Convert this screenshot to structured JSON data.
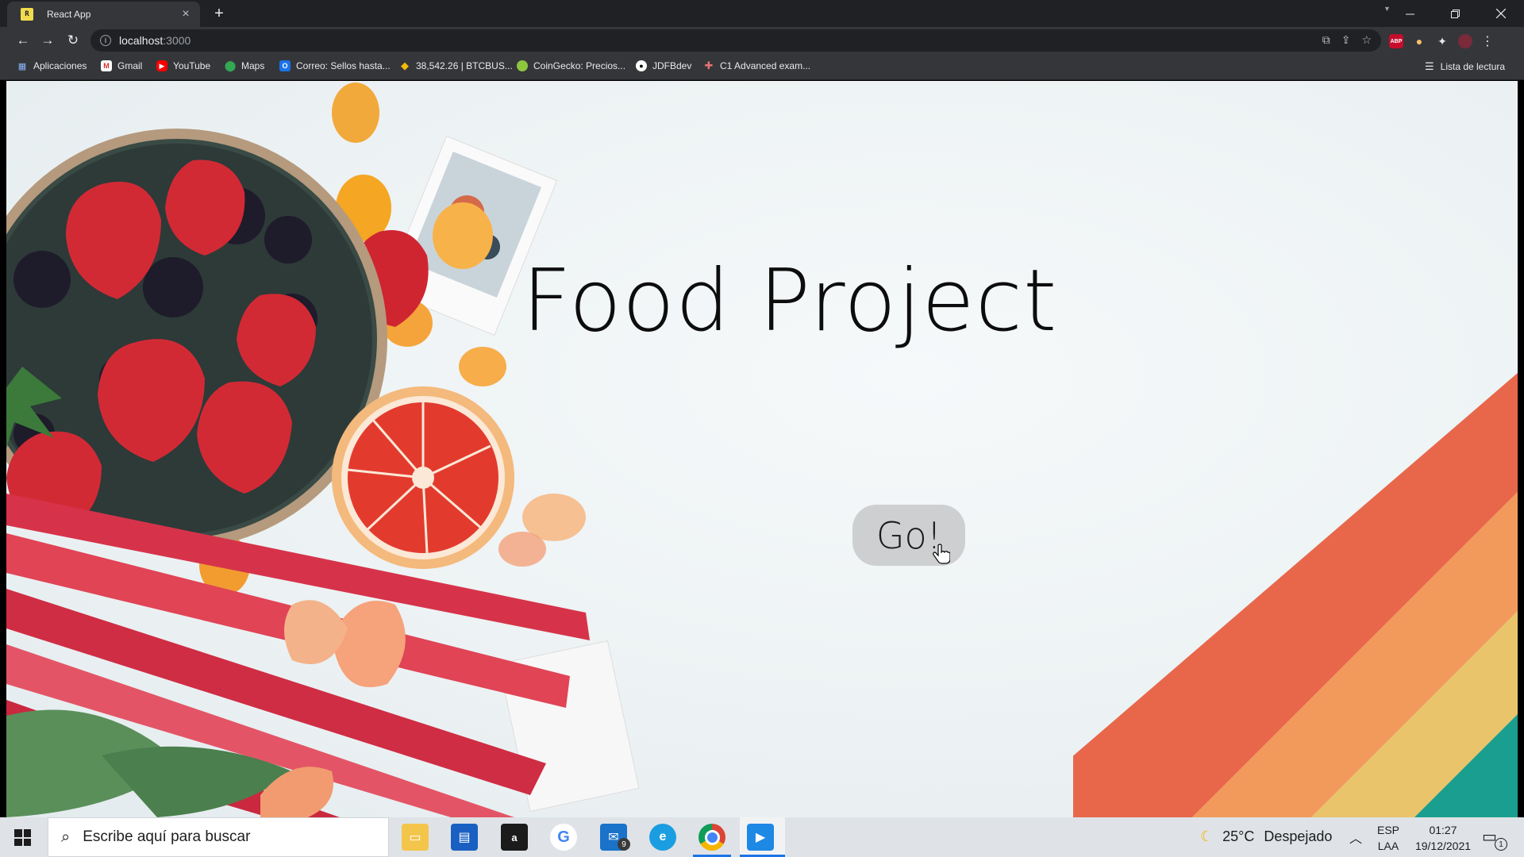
{
  "browser": {
    "tab_title": "React App",
    "tab_close_glyph": "×",
    "new_tab_glyph": "+",
    "url_host": "localhost",
    "url_port": ":3000",
    "back_glyph": "←",
    "forward_glyph": "→",
    "reload_glyph": "↻",
    "bookmarks": [
      {
        "label": "Aplicaciones",
        "icon": "apps-grid-icon"
      },
      {
        "label": "Gmail",
        "icon": "gmail-icon"
      },
      {
        "label": "YouTube",
        "icon": "youtube-icon"
      },
      {
        "label": "Maps",
        "icon": "maps-pin-icon"
      },
      {
        "label": "Correo: Sellos hasta...",
        "icon": "outlook-mail-icon"
      },
      {
        "label": "38,542.26 | BTCBUS...",
        "icon": "binance-icon"
      },
      {
        "label": "CoinGecko: Precios...",
        "icon": "coingecko-icon"
      },
      {
        "label": "JDFBdev",
        "icon": "github-icon"
      },
      {
        "label": "C1 Advanced exam...",
        "icon": "cambridge-icon"
      }
    ],
    "reading_list": "Lista de lectura",
    "extensions": {
      "abp": "ABP"
    }
  },
  "page": {
    "title": "Food Project",
    "go_button": "Go!"
  },
  "taskbar": {
    "search_placeholder": "Escribe aquí para buscar",
    "mail_badge": "9",
    "weather_temp": "25°C",
    "weather_desc": "Despejado",
    "lang_top": "ESP",
    "lang_bottom": "LAA",
    "time": "01:27",
    "date": "19/12/2021",
    "notification_count": "1"
  },
  "colors": {
    "stripe_red": "#e8674a",
    "stripe_orange": "#f29a5c",
    "stripe_yellow": "#e9c46a",
    "stripe_teal": "#1a9e8f",
    "button_bg": "#cdcfd0"
  }
}
